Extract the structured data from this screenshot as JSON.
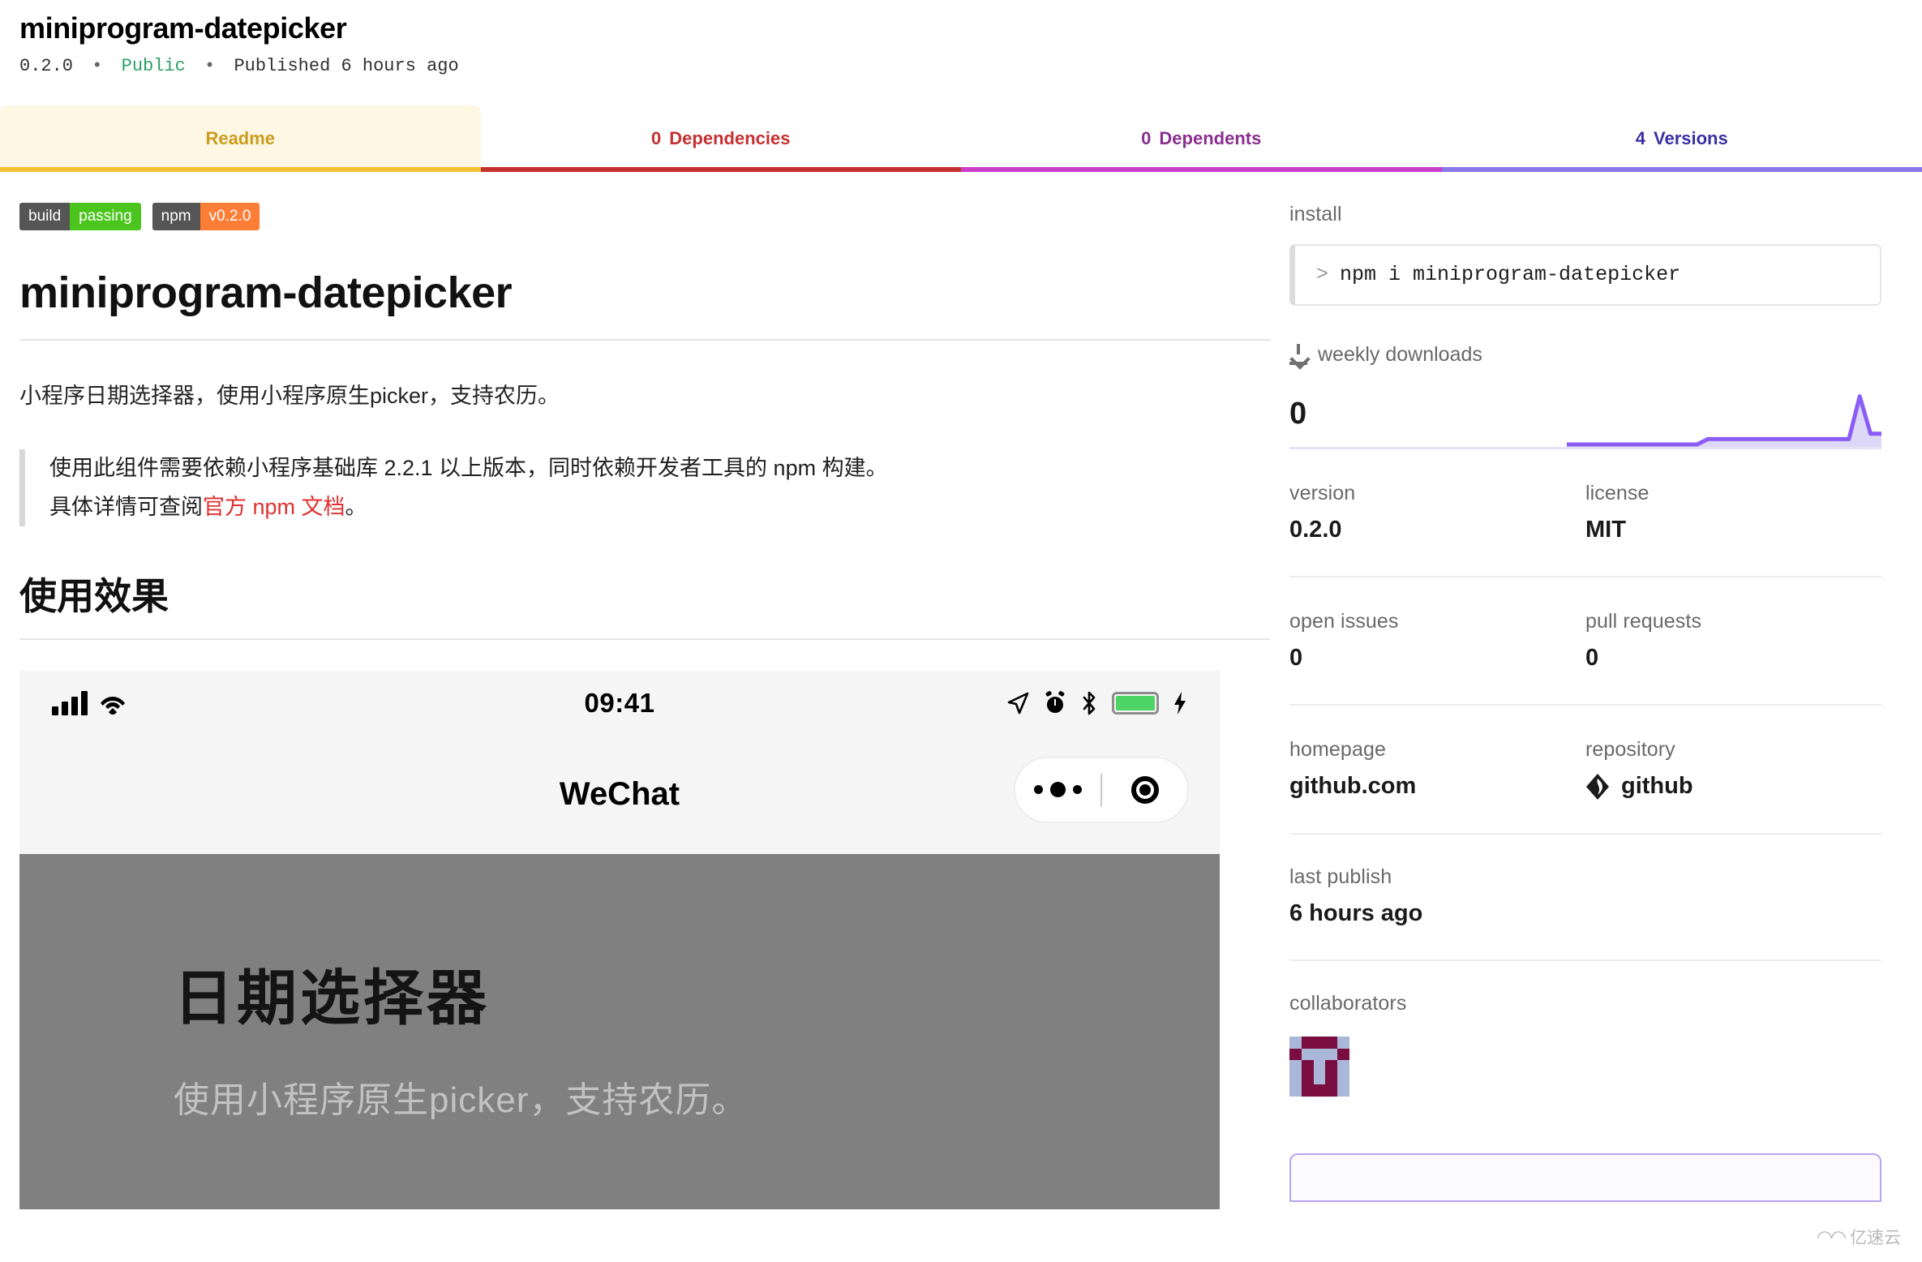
{
  "header": {
    "package_name": "miniprogram-datepicker",
    "version": "0.2.0",
    "separator": "•",
    "visibility": "Public",
    "published": "Published 6 hours ago"
  },
  "tabs": [
    {
      "label": "Readme",
      "count": ""
    },
    {
      "label": "Dependencies",
      "count": "0"
    },
    {
      "label": "Dependents",
      "count": "0"
    },
    {
      "label": "Versions",
      "count": "4"
    }
  ],
  "readme": {
    "badges": [
      {
        "left": "build",
        "right": "passing",
        "color": "#4bc51d"
      },
      {
        "left": "npm",
        "right": "v0.2.0",
        "color": "#fe7d37"
      }
    ],
    "heading": "miniprogram-datepicker",
    "paragraph": "小程序日期选择器，使用小程序原生picker，支持农历。",
    "quote_line1": "使用此组件需要依赖小程序基础库 2.2.1 以上版本，同时依赖开发者工具的 npm 构建。",
    "quote_line2_pre": "具体详情可查阅",
    "quote_link": "官方 npm 文档",
    "quote_line2_post": "。",
    "section_heading": "使用效果",
    "phone": {
      "time": "09:41",
      "app_title": "WeChat",
      "screen_title": "日期选择器",
      "screen_subtitle": "使用小程序原生picker，支持农历。"
    }
  },
  "sidebar": {
    "install_label": "install",
    "install_prompt": ">",
    "install_command": "npm i miniprogram-datepicker",
    "downloads_label": "weekly downloads",
    "downloads_count": "0",
    "version_label": "version",
    "version_value": "0.2.0",
    "license_label": "license",
    "license_value": "MIT",
    "open_issues_label": "open issues",
    "open_issues_value": "0",
    "pull_requests_label": "pull requests",
    "pull_requests_value": "0",
    "homepage_label": "homepage",
    "homepage_value": "github.com",
    "repository_label": "repository",
    "repository_value": "github",
    "last_publish_label": "last publish",
    "last_publish_value": "6 hours ago",
    "collaborators_label": "collaborators"
  },
  "watermark": {
    "glyph": "◠◠",
    "text": "亿速云"
  },
  "colors": {
    "readme_accent": "#f2c230",
    "dependencies_accent": "#c53030",
    "dependents_accent": "#cb3fcb",
    "versions_accent": "#8b77ec",
    "public_green": "#2ba06b",
    "link_red": "#e03131",
    "spark_purple": "#8b5cf6"
  },
  "chart_data": {
    "type": "area",
    "title": "weekly downloads",
    "x": [
      0,
      1,
      2,
      3,
      4,
      5,
      6,
      7,
      8,
      9,
      10,
      11,
      12,
      13,
      14,
      15,
      16,
      17,
      18,
      19,
      20,
      21,
      22,
      23,
      24,
      25,
      26,
      27,
      28,
      29
    ],
    "values": [
      0,
      0,
      0,
      0,
      0,
      0,
      0,
      0,
      0,
      0,
      0,
      0,
      0,
      1,
      1,
      1,
      1,
      1,
      1,
      1,
      1,
      1,
      1,
      1,
      1,
      1,
      1,
      9,
      2,
      2
    ],
    "ylim": [
      0,
      10
    ],
    "xlabel": "",
    "ylabel": "",
    "grid": false,
    "legend": "none",
    "line_color": "#8b5cf6",
    "fill_color": "#ded8f8"
  }
}
